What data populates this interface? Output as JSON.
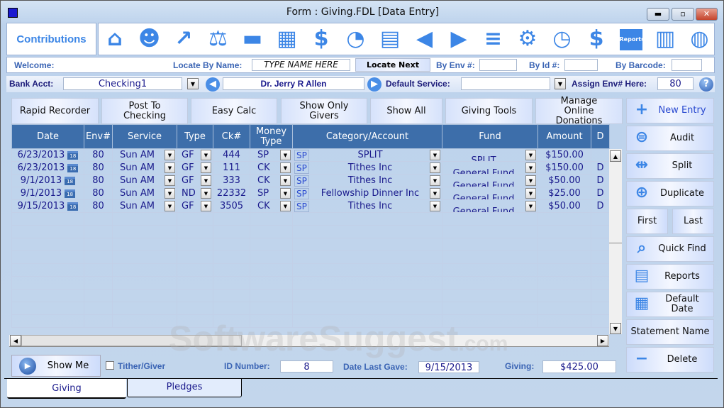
{
  "window": {
    "title": "Form : Giving.FDL [Data Entry]",
    "minimize": "▬",
    "maximize": "▫",
    "close": "✕"
  },
  "toolbar": {
    "section": "Contributions",
    "icons": [
      "home-icon",
      "people-icon",
      "chart-icon",
      "scales-icon",
      "check-icon",
      "abacus-icon",
      "money-bag-icon",
      "report-pie-icon",
      "spreadsheet-icon",
      "transfer-in-icon",
      "transfer-out-icon",
      "document-icon",
      "worker-settings-icon",
      "schedule-icon",
      "worker-money-icon",
      "reports-icon",
      "table-export-icon",
      "globe-icon"
    ],
    "reports_icon_text": "Reports"
  },
  "search": {
    "welcome": "Welcome:",
    "locate_by_name": "Locate By Name:",
    "name_placeholder": "TYPE NAME HERE",
    "locate_next": "Locate Next",
    "by_env": "By Env #:",
    "by_id": "By Id #:",
    "by_barcode": "By Barcode:"
  },
  "bank": {
    "label": "Bank Acct:",
    "value": "Checking1",
    "giver": "Dr. Jerry R Allen",
    "default_service_label": "Default Service:",
    "default_service": "",
    "assign_env_label": "Assign Env# Here:",
    "assign_env": "80"
  },
  "actions": [
    "Rapid Recorder",
    "Post To Checking",
    "Easy Calc",
    "Show Only Givers",
    "Show All",
    "Giving Tools",
    "Manage Online Donations"
  ],
  "grid": {
    "columns": [
      "Date",
      "Env#",
      "Service",
      "Type",
      "Ck#",
      "Money Type",
      "Category/Account",
      "Fund",
      "Amount",
      "D"
    ],
    "rows": [
      {
        "date": "6/23/2013",
        "env": "80",
        "service": "Sun AM",
        "type": "GF",
        "ck": "444",
        "money": "SP",
        "sp": "SP",
        "category": "SPLIT",
        "fund": "SPLIT",
        "amount": "$150.00",
        "d": ""
      },
      {
        "date": "6/23/2013",
        "env": "80",
        "service": "Sun AM",
        "type": "GF",
        "ck": "111",
        "money": "CK",
        "sp": "SP",
        "category": "Tithes Inc",
        "fund": "General Fund",
        "amount": "$150.00",
        "d": "D"
      },
      {
        "date": "9/1/2013",
        "env": "80",
        "service": "Sun AM",
        "type": "GF",
        "ck": "333",
        "money": "CK",
        "sp": "SP",
        "category": "Tithes Inc",
        "fund": "General Fund",
        "amount": "$50.00",
        "d": "D"
      },
      {
        "date": "9/1/2013",
        "env": "80",
        "service": "Sun AM",
        "type": "ND",
        "ck": "22332",
        "money": "SP",
        "sp": "SP",
        "category": "Fellowship Dinner Inc",
        "fund": "General Fund",
        "amount": "$25.00",
        "d": "D"
      },
      {
        "date": "9/15/2013",
        "env": "80",
        "service": "Sun AM",
        "type": "GF",
        "ck": "3505",
        "money": "CK",
        "sp": "SP",
        "category": "Tithes Inc",
        "fund": "General Fund",
        "amount": "$50.00",
        "d": "D"
      }
    ]
  },
  "side": {
    "new_entry": "New Entry",
    "audit": "Audit",
    "split": "Split",
    "duplicate": "Duplicate",
    "first": "First",
    "last": "Last",
    "quick_find": "Quick Find",
    "reports": "Reports",
    "default_date": "Default Date",
    "statement_name": "Statement Name",
    "delete": "Delete"
  },
  "footer": {
    "show_me": "Show Me",
    "tither": "Tither/Giver",
    "id_label": "ID Number:",
    "id": "8",
    "last_gave_label": "Date Last Gave:",
    "last_gave": "9/15/2013",
    "giving_label": "Giving:",
    "giving": "$425.00"
  },
  "tabs": [
    "Giving",
    "Pledges"
  ]
}
